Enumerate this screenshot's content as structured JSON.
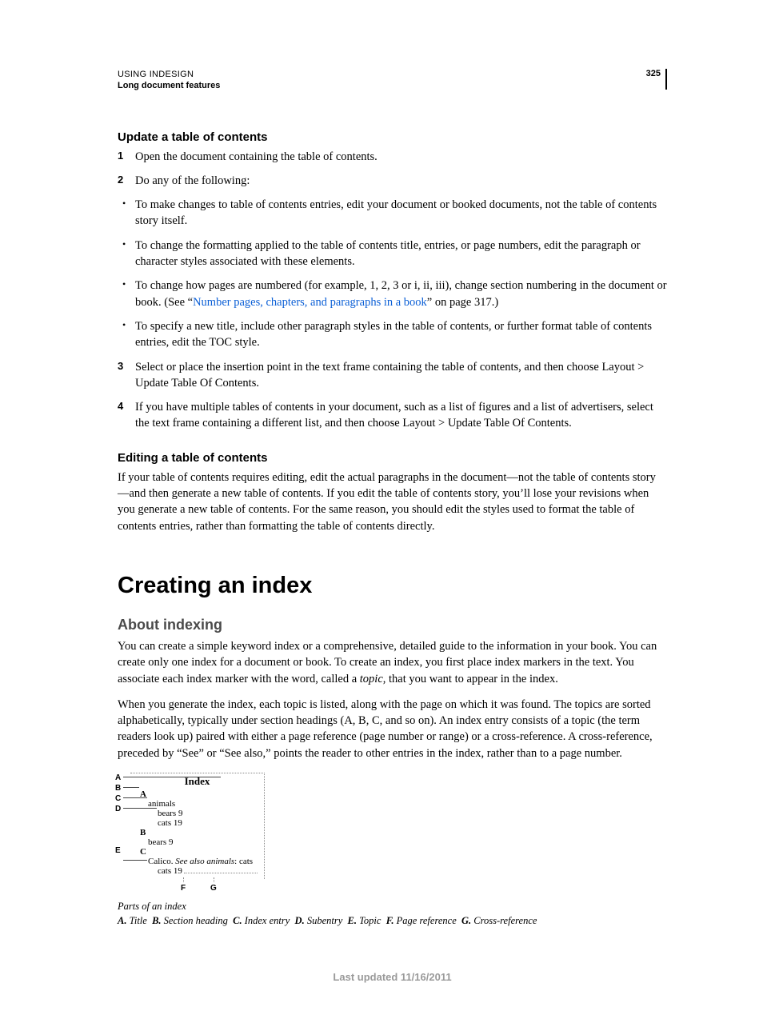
{
  "header": {
    "line1": "USING INDESIGN",
    "line2": "Long document features",
    "page_number": "325"
  },
  "section1": {
    "heading": "Update a table of contents",
    "step1_num": "1",
    "step1": "Open the document containing the table of contents.",
    "step2_num": "2",
    "step2": "Do any of the following:",
    "bullet1": "To make changes to table of contents entries, edit your document or booked documents, not the table of contents story itself.",
    "bullet2": "To change the formatting applied to the table of contents title, entries, or page numbers, edit the paragraph or character styles associated with these elements.",
    "bullet3a": "To change how pages are numbered (for example, 1, 2, 3 or i, ii, iii), change section numbering in the document or book. (See “",
    "bullet3_link": "Number pages, chapters, and paragraphs in a book",
    "bullet3b": "” on page 317.)",
    "bullet4": "To specify a new title, include other paragraph styles in the table of contents, or further format table of contents entries, edit the TOC style.",
    "step3_num": "3",
    "step3": "Select or place the insertion point in the text frame containing the table of contents, and then choose Layout > Update Table Of Contents.",
    "step4_num": "4",
    "step4": "If you have multiple tables of contents in your document, such as a list of figures and a list of advertisers, select the text frame containing a different list, and then choose Layout > Update Table Of Contents."
  },
  "section2": {
    "heading": "Editing a table of contents",
    "para": "If your table of contents requires editing, edit the actual paragraphs in the document—not the table of contents story—and then generate a new table of contents. If you edit the table of contents story, you’ll lose your revisions when you generate a new table of contents. For the same reason, you should edit the styles used to format the table of contents entries, rather than formatting the table of contents directly."
  },
  "section3": {
    "h1": "Creating an index",
    "h2": "About indexing",
    "para1a": "You can create a simple keyword index or a comprehensive, detailed guide to the information in your book. You can create only one index for a document or book. To create an index, you first place index markers in the text. You associate each index marker with the word, called a ",
    "para1_em": "topic",
    "para1b": ", that you want to appear in the index.",
    "para2": "When you generate the index, each topic is listed, along with the page on which it was found. The topics are sorted alphabetically, typically under section headings (A, B, C, and so on). An index entry consists of a topic (the term readers look up) paired with either a page reference (page number or range) or a cross-reference. A cross-reference, preceded by “See” or “See also,” points the reader to other entries in the index, rather than to a page number."
  },
  "figure": {
    "title": "Index",
    "callout_A": "A",
    "callout_B": "B",
    "callout_C": "C",
    "callout_D": "D",
    "callout_E": "E",
    "callout_F": "F",
    "callout_G": "G",
    "sec_A": "A",
    "entry_animals": "animals",
    "sub_bears": "bears  9",
    "sub_cats": "cats  19",
    "sec_B": "B",
    "entry_bearsB": "bears  9",
    "sec_C": "C",
    "cross_text1": "Calico. ",
    "cross_see": "See also animals",
    "cross_text2": ": cats",
    "cross_sub": "cats  19",
    "caption_title": "Parts of an index",
    "legend": {
      "A": "Title",
      "B": "Section heading",
      "C": "Index entry",
      "D": "Subentry",
      "E": "Topic",
      "F": "Page reference",
      "G": "Cross-reference"
    }
  },
  "footer": "Last updated 11/16/2011"
}
